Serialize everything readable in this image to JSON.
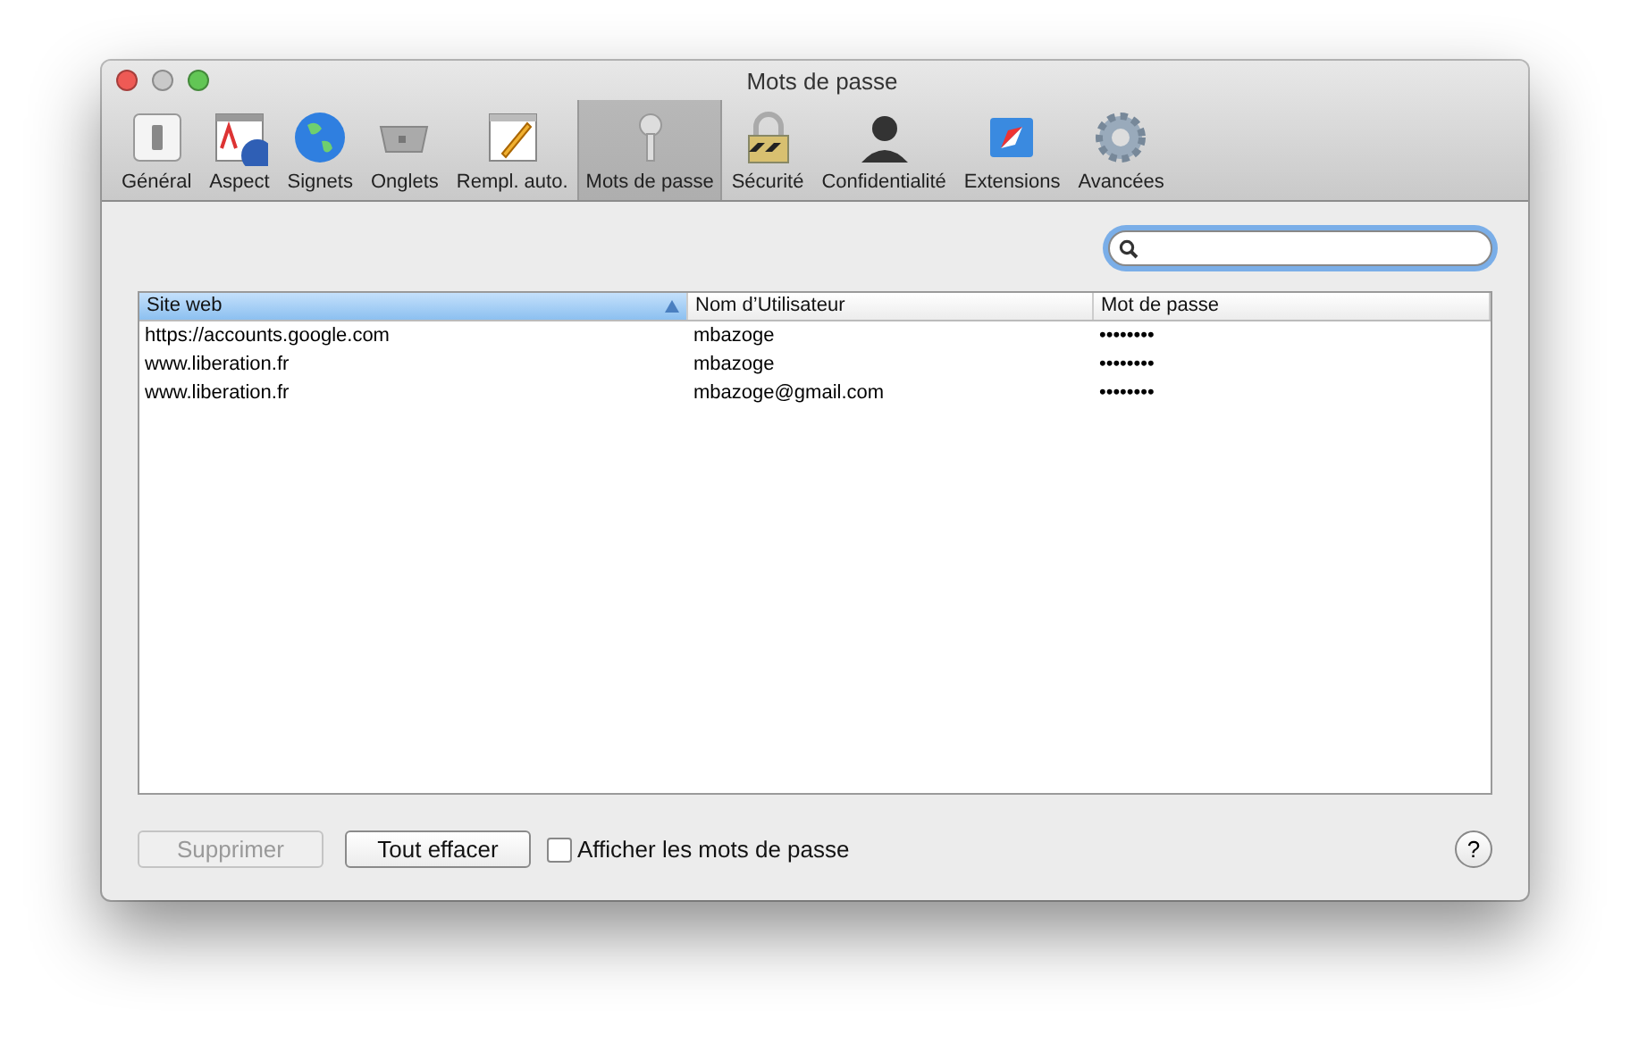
{
  "window": {
    "title": "Mots de passe",
    "controls": [
      {
        "kind": "close",
        "disabled": false
      },
      {
        "kind": "minimize",
        "disabled": true
      },
      {
        "kind": "zoom",
        "disabled": false
      }
    ]
  },
  "toolbar": [
    {
      "label": "Général",
      "selected": false
    },
    {
      "label": "Aspect",
      "selected": false
    },
    {
      "label": "Signets",
      "selected": false
    },
    {
      "label": "Onglets",
      "selected": false
    },
    {
      "label": "Rempl. auto.",
      "selected": false
    },
    {
      "label": "Mots de passe",
      "selected": true
    },
    {
      "label": "Sécurité",
      "selected": false
    },
    {
      "label": "Confidentialité",
      "selected": false
    },
    {
      "label": "Extensions",
      "selected": false
    },
    {
      "label": "Avancées",
      "selected": false
    }
  ],
  "search": {
    "focused": true
  },
  "table": {
    "columns": [
      {
        "label": "Site web",
        "selected": true
      },
      {
        "label": "Nom d’Utilisateur",
        "selected": false
      },
      {
        "label": "Mot de passe",
        "selected": false
      }
    ],
    "rows": [
      [
        "https://accounts.google.com",
        "mbazoge",
        "••••••••"
      ],
      [
        "www.liberation.fr",
        "mbazoge",
        "••••••••"
      ],
      [
        "www.liberation.fr",
        "mbazoge@gmail.com",
        "••••••••"
      ]
    ]
  },
  "buttons": [
    {
      "label": "Supprimer",
      "disabled": true
    },
    {
      "label": "Tout effacer",
      "disabled": false
    }
  ],
  "show_passwords": {
    "label": "Afficher les mots de passe",
    "checked": false
  },
  "help": {
    "label": "?"
  }
}
